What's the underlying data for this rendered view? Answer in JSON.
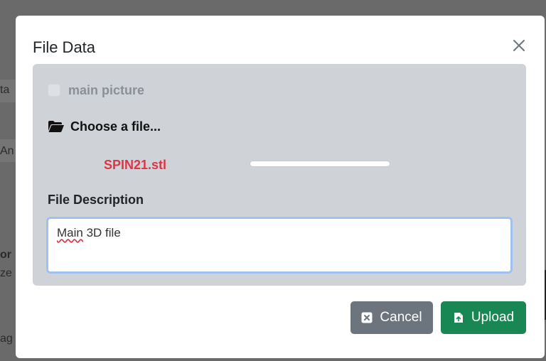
{
  "background": {
    "texts": [
      "ta",
      "An",
      "or",
      "ze",
      "ag"
    ]
  },
  "modal": {
    "title": "File Data",
    "close_icon": "close-icon",
    "main_picture_label": "main picture",
    "main_picture_checked": false,
    "choose_file_label": "Choose a file...",
    "choose_file_icon": "folder-open-icon",
    "file": {
      "name": "SPIN21.stl",
      "upload_progress": 0
    },
    "description": {
      "label": "File Description",
      "value_misspelled": "Main",
      "value_rest": " 3D file"
    },
    "buttons": {
      "cancel_label": "Cancel",
      "cancel_icon": "x-square-icon",
      "upload_label": "Upload",
      "upload_icon": "file-upload-icon"
    }
  },
  "colors": {
    "file_name": "#dc3545",
    "upload_button": "#198754",
    "cancel_button": "#6c757d",
    "panel": "#cfd3d8"
  }
}
